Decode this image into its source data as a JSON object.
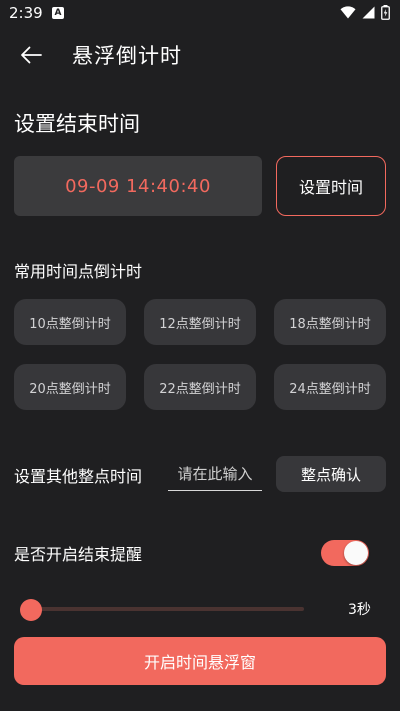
{
  "status_bar": {
    "time": "2:39",
    "notification_letter": "A",
    "icons": [
      "wifi-icon",
      "signal-icon",
      "battery-icon"
    ]
  },
  "app_bar": {
    "title": "悬浮倒计时",
    "back_icon": "arrow-left-icon"
  },
  "end_time": {
    "section_title": "设置结束时间",
    "value": "09-09 14:40:40",
    "set_button_label": "设置时间"
  },
  "presets": {
    "title": "常用时间点倒计时",
    "items": [
      {
        "label": "10点整倒计时"
      },
      {
        "label": "12点整倒计时"
      },
      {
        "label": "18点整倒计时"
      },
      {
        "label": "20点整倒计时"
      },
      {
        "label": "22点整倒计时"
      },
      {
        "label": "24点整倒计时"
      }
    ]
  },
  "other_hour": {
    "label": "设置其他整点时间",
    "placeholder": "请在此输入",
    "confirm_label": "整点确认"
  },
  "reminder": {
    "label": "是否开启结束提醒",
    "enabled": true,
    "slider_value": "3秒"
  },
  "start_button_label": "开启时间悬浮窗",
  "colors": {
    "accent": "#f2695e",
    "background": "#1f1f21",
    "card": "#37373a"
  }
}
